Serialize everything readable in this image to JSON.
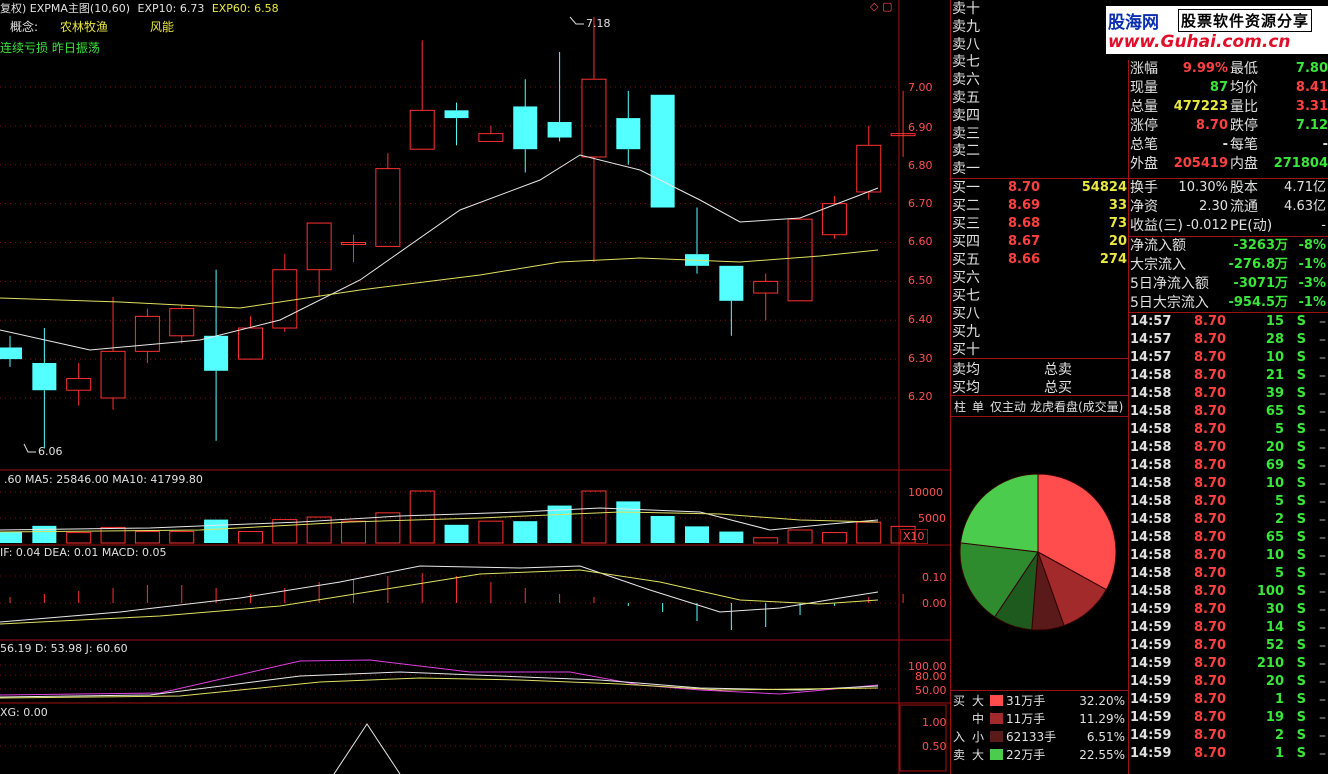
{
  "header": {
    "title": "复权) EXPMA主图(10,60)",
    "exp10": "EXP10: 6.73",
    "exp60": "EXP60: 6.58",
    "concept_label": "概念:",
    "concept_value": "农林牧渔",
    "risk_label": "风能",
    "signal_text": "连续亏损 昨日振荡"
  },
  "price_axis": {
    "ticks": [
      "7.00",
      "6.90",
      "6.80",
      "6.70",
      "6.60",
      "6.50",
      "6.40",
      "6.30",
      "6.20"
    ],
    "high_label": "7.18",
    "low_label": "6.06"
  },
  "candles": [
    {
      "o": 6.33,
      "c": 6.3,
      "h": 6.36,
      "l": 6.28
    },
    {
      "o": 6.29,
      "c": 6.22,
      "h": 6.38,
      "l": 6.07
    },
    {
      "o": 6.22,
      "c": 6.25,
      "h": 6.29,
      "l": 6.18
    },
    {
      "o": 6.2,
      "c": 6.32,
      "h": 6.46,
      "l": 6.17
    },
    {
      "o": 6.32,
      "c": 6.41,
      "h": 6.43,
      "l": 6.29
    },
    {
      "o": 6.36,
      "c": 6.43,
      "h": 6.44,
      "l": 6.34
    },
    {
      "o": 6.36,
      "c": 6.27,
      "h": 6.53,
      "l": 6.09
    },
    {
      "o": 6.3,
      "c": 6.38,
      "h": 6.41,
      "l": 6.3
    },
    {
      "o": 6.38,
      "c": 6.53,
      "h": 6.57,
      "l": 6.37
    },
    {
      "o": 6.53,
      "c": 6.65,
      "h": 6.65,
      "l": 6.46
    },
    {
      "o": 6.6,
      "c": 6.6,
      "h": 6.62,
      "l": 6.55
    },
    {
      "o": 6.59,
      "c": 6.79,
      "h": 6.83,
      "l": 6.59
    },
    {
      "o": 6.84,
      "c": 6.94,
      "h": 7.12,
      "l": 6.84
    },
    {
      "o": 6.94,
      "c": 6.92,
      "h": 6.96,
      "l": 6.85
    },
    {
      "o": 6.86,
      "c": 6.88,
      "h": 6.9,
      "l": 6.86
    },
    {
      "o": 6.95,
      "c": 6.84,
      "h": 7.02,
      "l": 6.78
    },
    {
      "o": 6.91,
      "c": 6.87,
      "h": 7.09,
      "l": 6.86
    },
    {
      "o": 6.82,
      "c": 7.02,
      "h": 7.18,
      "l": 6.55
    },
    {
      "o": 6.92,
      "c": 6.84,
      "h": 6.99,
      "l": 6.8
    },
    {
      "o": 6.98,
      "c": 6.69,
      "h": 6.98,
      "l": 6.69
    },
    {
      "o": 6.57,
      "c": 6.54,
      "h": 6.69,
      "l": 6.52
    },
    {
      "o": 6.54,
      "c": 6.45,
      "h": 6.54,
      "l": 6.36
    },
    {
      "o": 6.47,
      "c": 6.5,
      "h": 6.52,
      "l": 6.4
    },
    {
      "o": 6.45,
      "c": 6.66,
      "h": 6.66,
      "l": 6.45
    },
    {
      "o": 6.62,
      "c": 6.7,
      "h": 6.72,
      "l": 6.61
    },
    {
      "o": 6.73,
      "c": 6.85,
      "h": 6.9,
      "l": 6.71
    },
    {
      "o": 6.88,
      "c": 6.88,
      "h": 6.99,
      "l": 6.82
    }
  ],
  "volume": {
    "label": ".60  MA5: 25846.00  MA10: 41799.80",
    "ticks": [
      "10000",
      "5000"
    ],
    "unit": "X10",
    "bars": [
      0.22,
      0.33,
      0.2,
      0.3,
      0.22,
      0.22,
      0.45,
      0.22,
      0.45,
      0.5,
      0.42,
      0.58,
      1.0,
      0.35,
      0.42,
      0.42,
      0.72,
      1.0,
      0.8,
      0.52,
      0.32,
      0.22,
      0.1,
      0.25,
      0.2,
      0.4,
      0.32
    ]
  },
  "macd": {
    "label": "IF: 0.04  DEA: 0.01  MACD: 0.05",
    "ticks": [
      "0.10",
      "0.00"
    ]
  },
  "kdj": {
    "label": "56.19  D: 53.98  J: 60.60",
    "ticks": [
      "100.00",
      "80.00",
      "50.00"
    ]
  },
  "xg": {
    "label": "XG: 0.00",
    "ticks": [
      "1.00",
      "0.50"
    ]
  },
  "watermark": {
    "brand": "股海网",
    "slogan": "股票软件资源分享",
    "url": "www.Guhai.com.cn"
  },
  "sell_levels": [
    "卖十",
    "卖九",
    "卖八",
    "卖七",
    "卖六",
    "卖五",
    "卖四",
    "卖三",
    "卖二",
    "卖一"
  ],
  "buy_levels": [
    {
      "label": "买一",
      "price": "8.70",
      "vol": "54824"
    },
    {
      "label": "买二",
      "price": "8.69",
      "vol": "33"
    },
    {
      "label": "买三",
      "price": "8.68",
      "vol": "73"
    },
    {
      "label": "买四",
      "price": "8.67",
      "vol": "20"
    },
    {
      "label": "买五",
      "price": "8.66",
      "vol": "274"
    },
    {
      "label": "买六",
      "price": "",
      "vol": ""
    },
    {
      "label": "买七",
      "price": "",
      "vol": ""
    },
    {
      "label": "买八",
      "price": "",
      "vol": ""
    },
    {
      "label": "买九",
      "price": "",
      "vol": ""
    },
    {
      "label": "买十",
      "price": "",
      "vol": ""
    }
  ],
  "averages": {
    "sell_avg": "卖均",
    "sell_total": "总卖",
    "buy_avg": "买均",
    "buy_total": "总买"
  },
  "tabs": [
    "柱",
    "单",
    "仅主动",
    "龙虎看盘(成交量)"
  ],
  "quote": [
    {
      "l1": "涨幅",
      "v1": "9.99%",
      "l2": "最低",
      "v2": "7.80",
      "c1": "red",
      "c2": "green"
    },
    {
      "l1": "现量",
      "v1": "87",
      "l2": "均价",
      "v2": "8.41",
      "c1": "green",
      "c2": "red"
    },
    {
      "l1": "总量",
      "v1": "477223",
      "l2": "量比",
      "v2": "3.31",
      "c1": "yellow",
      "c2": "red"
    },
    {
      "l1": "涨停",
      "v1": "8.70",
      "l2": "跌停",
      "v2": "7.12",
      "c1": "red",
      "c2": "green"
    },
    {
      "l1": "总笔",
      "v1": "-",
      "l2": "每笔",
      "v2": "-",
      "c1": "white",
      "c2": "white"
    },
    {
      "l1": "外盘",
      "v1": "205419",
      "l2": "内盘",
      "v2": "271804",
      "c1": "red",
      "c2": "green"
    }
  ],
  "fundamentals": [
    {
      "l1": "换手",
      "v1": "10.30%",
      "l2": "股本",
      "v2": "4.71亿"
    },
    {
      "l1": "净资",
      "v1": "2.30",
      "l2": "流通",
      "v2": "4.63亿"
    },
    {
      "l1": "收益(三)",
      "v1": "-0.012",
      "l2": "PE(动)",
      "v2": "-"
    }
  ],
  "fund_flow": [
    {
      "label": "净流入额",
      "value": "-3263万",
      "pct": "-8%"
    },
    {
      "label": "大宗流入",
      "value": "-276.8万",
      "pct": "-1%"
    },
    {
      "label": "5日净流入额",
      "value": "-3071万",
      "pct": "-3%"
    },
    {
      "label": "5日大宗流入",
      "value": "-954.5万",
      "pct": "-1%"
    }
  ],
  "ticks_list": [
    {
      "t": "14:57",
      "p": "8.70",
      "v": "15",
      "s": "S"
    },
    {
      "t": "14:57",
      "p": "8.70",
      "v": "28",
      "s": "S"
    },
    {
      "t": "14:57",
      "p": "8.70",
      "v": "10",
      "s": "S"
    },
    {
      "t": "14:58",
      "p": "8.70",
      "v": "21",
      "s": "S"
    },
    {
      "t": "14:58",
      "p": "8.70",
      "v": "39",
      "s": "S"
    },
    {
      "t": "14:58",
      "p": "8.70",
      "v": "65",
      "s": "S"
    },
    {
      "t": "14:58",
      "p": "8.70",
      "v": "5",
      "s": "S"
    },
    {
      "t": "14:58",
      "p": "8.70",
      "v": "20",
      "s": "S"
    },
    {
      "t": "14:58",
      "p": "8.70",
      "v": "69",
      "s": "S"
    },
    {
      "t": "14:58",
      "p": "8.70",
      "v": "10",
      "s": "S"
    },
    {
      "t": "14:58",
      "p": "8.70",
      "v": "5",
      "s": "S"
    },
    {
      "t": "14:58",
      "p": "8.70",
      "v": "2",
      "s": "S"
    },
    {
      "t": "14:58",
      "p": "8.70",
      "v": "65",
      "s": "S"
    },
    {
      "t": "14:58",
      "p": "8.70",
      "v": "10",
      "s": "S"
    },
    {
      "t": "14:58",
      "p": "8.70",
      "v": "5",
      "s": "S"
    },
    {
      "t": "14:58",
      "p": "8.70",
      "v": "100",
      "s": "S"
    },
    {
      "t": "14:59",
      "p": "8.70",
      "v": "30",
      "s": "S"
    },
    {
      "t": "14:59",
      "p": "8.70",
      "v": "14",
      "s": "S"
    },
    {
      "t": "14:59",
      "p": "8.70",
      "v": "52",
      "s": "S"
    },
    {
      "t": "14:59",
      "p": "8.70",
      "v": "210",
      "s": "S"
    },
    {
      "t": "14:59",
      "p": "8.70",
      "v": "20",
      "s": "S"
    },
    {
      "t": "14:59",
      "p": "8.70",
      "v": "1",
      "s": "S"
    },
    {
      "t": "14:59",
      "p": "8.70",
      "v": "19",
      "s": "S"
    },
    {
      "t": "14:59",
      "p": "8.70",
      "v": "2",
      "s": "S"
    },
    {
      "t": "14:59",
      "p": "8.70",
      "v": "1",
      "s": "S"
    }
  ],
  "pie": {
    "slices": [
      {
        "value": 32.2,
        "color": "#ff4d4d"
      },
      {
        "value": 11.29,
        "color": "#a32a2a"
      },
      {
        "value": 6.51,
        "color": "#5a1a1a"
      },
      {
        "value": 7.9,
        "color": "#1e5a1e"
      },
      {
        "value": 17.08,
        "color": "#2e8b2e"
      },
      {
        "value": 22.55,
        "color": "#4ccc4c"
      }
    ]
  },
  "flow_table": [
    {
      "side": "买",
      "size": "大",
      "amount": "31万手",
      "pct": "32.20%",
      "color": "#ff4d4d"
    },
    {
      "side": "",
      "size": "中",
      "amount": "11万手",
      "pct": "11.29%",
      "color": "#a32a2a"
    },
    {
      "side": "入",
      "size": "小",
      "amount": "62133手",
      "pct": "6.51%",
      "color": "#5a1a1a"
    },
    {
      "side": "卖",
      "size": "大",
      "amount": "22万手",
      "pct": "22.55%",
      "color": "#4ccc4c"
    }
  ]
}
